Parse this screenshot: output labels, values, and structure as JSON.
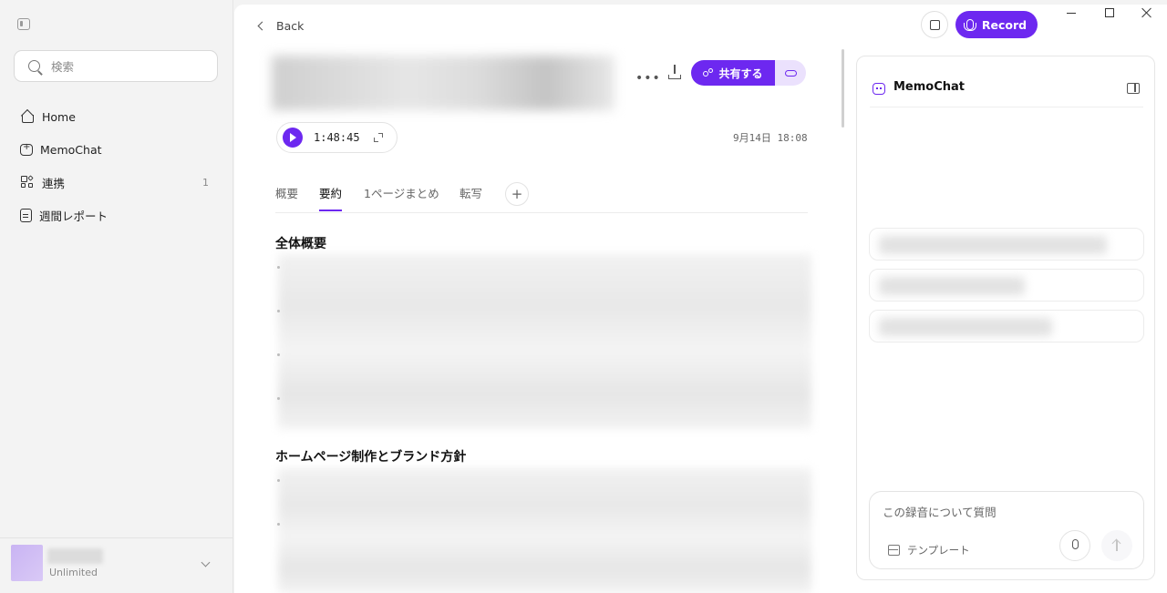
{
  "sidebar": {
    "search_placeholder": "検索",
    "items": [
      {
        "label": "Home"
      },
      {
        "label": "MemoChat"
      },
      {
        "label": "連携",
        "count": "1"
      },
      {
        "label": "週間レポート"
      }
    ],
    "footer": {
      "plan": "Unlimited"
    }
  },
  "header": {
    "back_label": "Back",
    "record_label": "Record"
  },
  "recording": {
    "share_label": "共有する",
    "duration": "1:48:45",
    "date": "9月14日 18:08"
  },
  "tabs": [
    {
      "label": "概要"
    },
    {
      "label": "要約",
      "active": true
    },
    {
      "label": "1ページまとめ"
    },
    {
      "label": "転写"
    }
  ],
  "sections": [
    {
      "title": "全体概要"
    },
    {
      "title": "ホームページ制作とブランド方針"
    }
  ],
  "chat": {
    "title": "MemoChat",
    "input_placeholder": "この録音について質問",
    "template_label": "テンプレート"
  },
  "colors": {
    "accent": "#6d28f0",
    "accent_light": "#ebe1fd"
  }
}
